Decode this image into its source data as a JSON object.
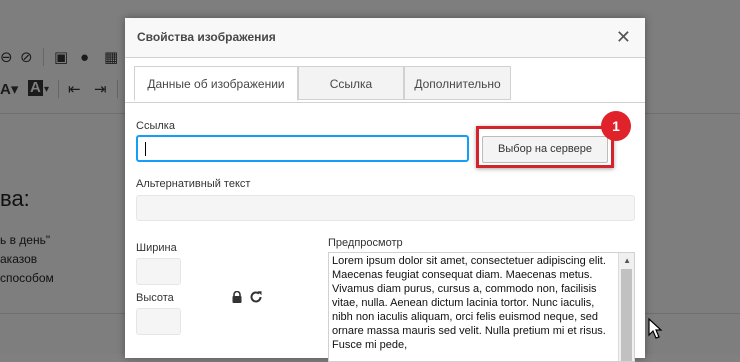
{
  "background_editor": {
    "heading": "ва:",
    "lines": [
      "ь в день\"",
      "аказов",
      "способом"
    ]
  },
  "dialog": {
    "title": "Свойства изображения",
    "tabs": [
      {
        "label": "Данные об изображении",
        "active": true
      },
      {
        "label": "Ссылка",
        "active": false
      },
      {
        "label": "Дополнительно",
        "active": false
      }
    ],
    "url_label": "Ссылка",
    "url_value": "",
    "browse_button": "Выбор на сервере",
    "badge_number": "1",
    "alt_label": "Альтернативный текст",
    "alt_value": "",
    "width_label": "Ширина",
    "height_label": "Высота",
    "preview_label": "Предпросмотр",
    "preview_text": "Lorem ipsum dolor sit amet, consectetuer adipiscing elit. Maecenas feugiat consequat diam. Maecenas metus. Vivamus diam purus, cursus a, commodo non, facilisis vitae, nulla. Aenean dictum lacinia tortor. Nunc iaculis, nibh non iaculis aliquam, orci felis euismod neque, sed ornare massa mauris sed velit. Nulla pretium mi et risus. Fusce mi pede,"
  },
  "colors": {
    "overlay": "#808080",
    "focus_border": "#139ff7",
    "highlight": "#d5232b"
  }
}
